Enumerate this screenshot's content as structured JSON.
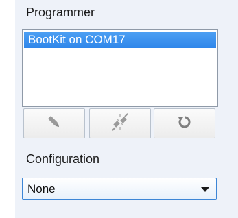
{
  "programmer": {
    "label": "Programmer",
    "items": [
      {
        "label": "BootKit on COM17",
        "selected": true
      }
    ]
  },
  "toolbar": {
    "program_icon": "pen-icon",
    "erase_icon": "plug-disconnect-icon",
    "refresh_icon": "refresh-icon"
  },
  "configuration": {
    "label": "Configuration",
    "selected": "None"
  },
  "colors": {
    "selection": "#3b8fef",
    "panel": "#eef2f9",
    "dropdown_border": "#3d86d6"
  }
}
